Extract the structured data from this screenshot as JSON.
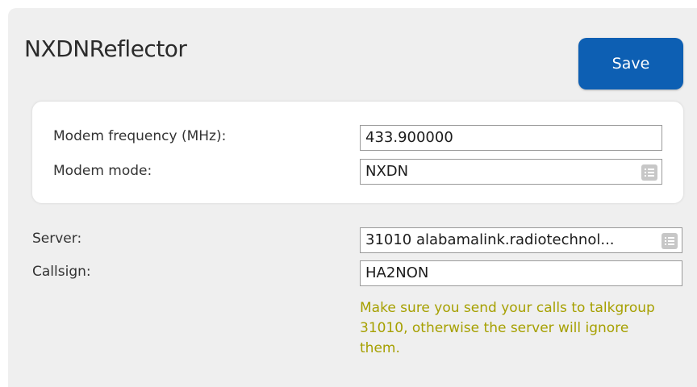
{
  "panel": {
    "title": "NXDNReflector",
    "save_label": "Save"
  },
  "modem": {
    "frequency_label": "Modem frequency (MHz):",
    "frequency_value": "433.900000",
    "mode_label": "Modem mode:",
    "mode_value": "NXDN"
  },
  "reflector": {
    "server_label": "Server:",
    "server_value": "31010 alabamalink.radiotechnol...",
    "callsign_label": "Callsign:",
    "callsign_value": "HA2NON",
    "hint": "Make sure you send your calls to talkgroup 31010, otherwise the server will ignore them."
  },
  "icons": {
    "select": "list-icon"
  },
  "colors": {
    "accent": "#0d5fb3",
    "hint": "#a6a000",
    "panel_bg": "#efefef"
  }
}
